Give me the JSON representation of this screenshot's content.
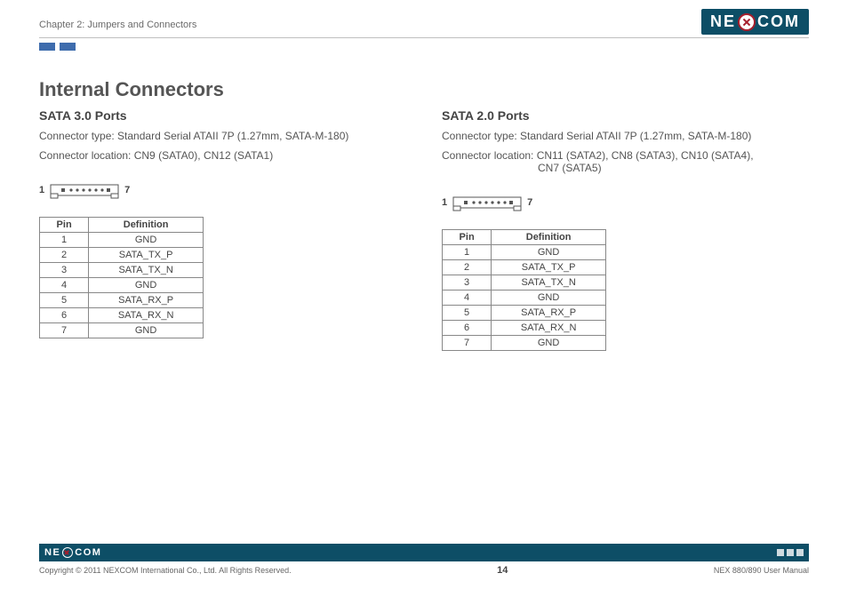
{
  "header": {
    "chapter": "Chapter 2: Jumpers and Connectors",
    "logo_text_left": "NE",
    "logo_text_right": "COM"
  },
  "title": "Internal Connectors",
  "left": {
    "heading": "SATA 3.0 Ports",
    "line1": "Connector type: Standard Serial ATAII 7P (1.27mm, SATA-M-180)",
    "line2": "Connector location: CN9 (SATA0), CN12 (SATA1)",
    "diagram": {
      "left": "1",
      "right": "7"
    },
    "table": {
      "head_pin": "Pin",
      "head_def": "Definition",
      "rows": [
        {
          "pin": "1",
          "def": "GND"
        },
        {
          "pin": "2",
          "def": "SATA_TX_P"
        },
        {
          "pin": "3",
          "def": "SATA_TX_N"
        },
        {
          "pin": "4",
          "def": "GND"
        },
        {
          "pin": "5",
          "def": "SATA_RX_P"
        },
        {
          "pin": "6",
          "def": "SATA_RX_N"
        },
        {
          "pin": "7",
          "def": "GND"
        }
      ]
    }
  },
  "right": {
    "heading": "SATA 2.0 Ports",
    "line1": "Connector type: Standard Serial ATAII 7P (1.27mm, SATA-M-180)",
    "line2": "Connector location: CN11 (SATA2), CN8 (SATA3), CN10 (SATA4),",
    "line3": "CN7 (SATA5)",
    "diagram": {
      "left": "1",
      "right": "7"
    },
    "table": {
      "head_pin": "Pin",
      "head_def": "Definition",
      "rows": [
        {
          "pin": "1",
          "def": "GND"
        },
        {
          "pin": "2",
          "def": "SATA_TX_P"
        },
        {
          "pin": "3",
          "def": "SATA_TX_N"
        },
        {
          "pin": "4",
          "def": "GND"
        },
        {
          "pin": "5",
          "def": "SATA_RX_P"
        },
        {
          "pin": "6",
          "def": "SATA_RX_N"
        },
        {
          "pin": "7",
          "def": "GND"
        }
      ]
    }
  },
  "footer": {
    "logo_text_left": "NE",
    "logo_text_right": "COM",
    "copyright": "Copyright © 2011 NEXCOM International Co., Ltd. All Rights Reserved.",
    "page_number": "14",
    "manual": "NEX 880/890 User Manual"
  }
}
